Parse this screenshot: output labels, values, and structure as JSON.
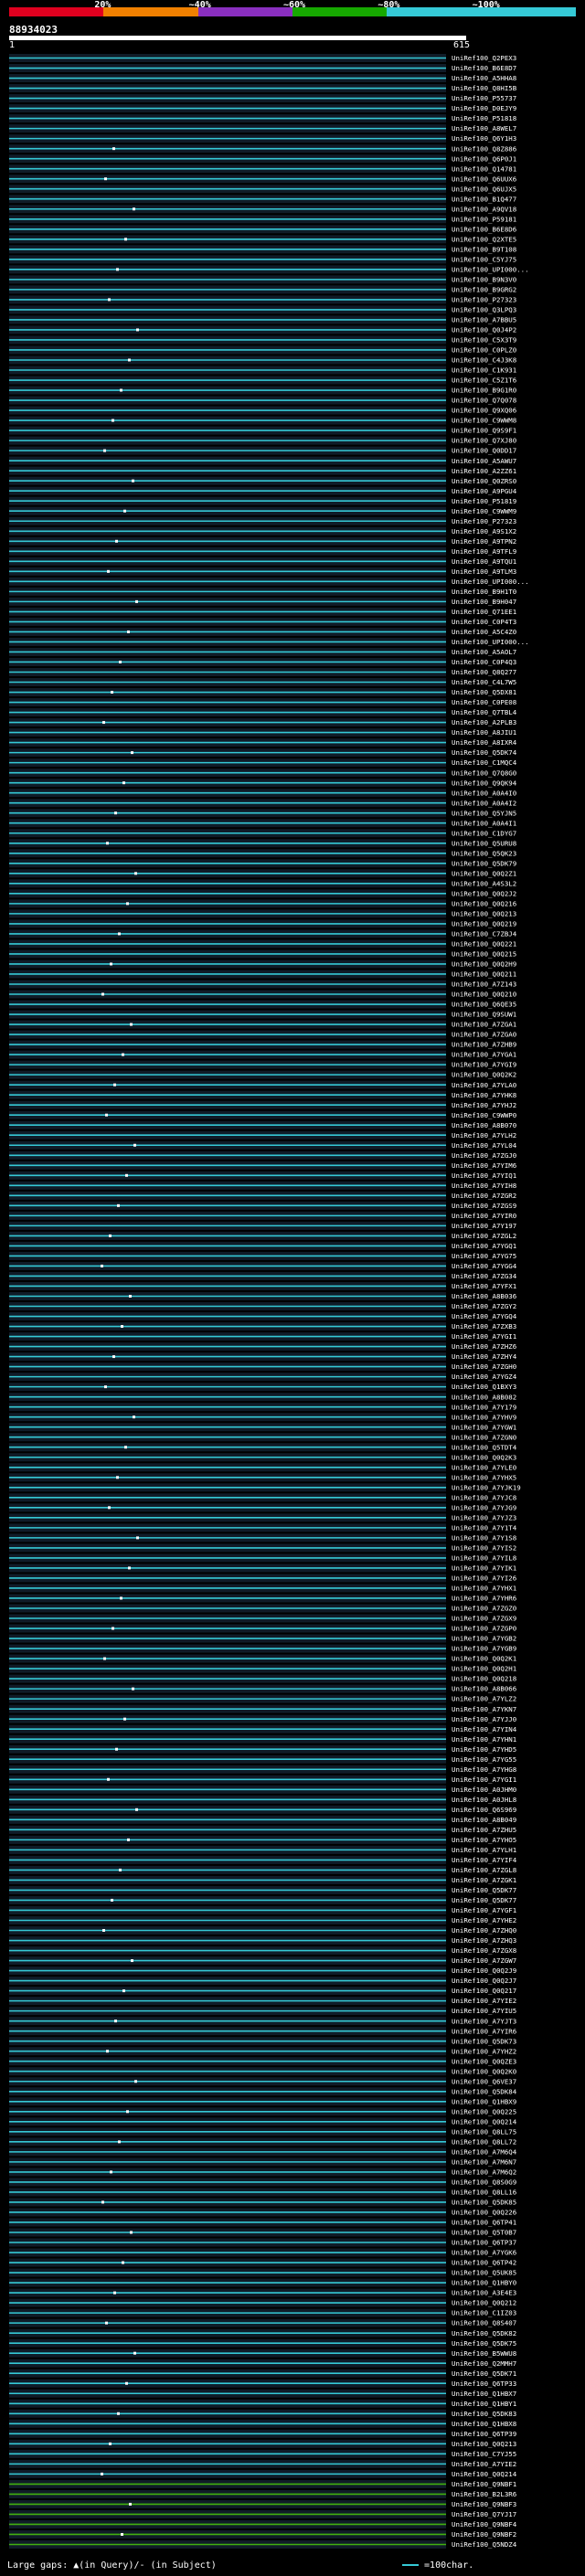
{
  "header": {
    "legend": [
      {
        "label": "",
        "color": "#e0001f"
      },
      {
        "label": "20%",
        "color": "#f08000"
      },
      {
        "label": "~40%",
        "color": "#8a2fc0"
      },
      {
        "label": "~60%",
        "color": "#16a800"
      },
      {
        "label": "~80%",
        "color": "#35c9d6"
      },
      {
        "label": "~100%",
        "color": "#35c9d6"
      }
    ],
    "query_id": "88934023",
    "scale_start": "1",
    "scale_end": "615"
  },
  "colors": {
    "hit": "#35c9d6",
    "hit_green": "#41b010",
    "gap": "#101c28",
    "dot": "#ffffff"
  },
  "hits": [
    "UniRef100_Q2PEX3",
    "UniRef100_B6E8D7",
    "UniRef100_A5HHA8",
    "UniRef100_Q8HI5B",
    "UniRef100_P55737",
    "UniRef100_D0EJY9",
    "UniRef100_P51818",
    "UniRef100_A8WEL7",
    "UniRef100_Q6Y1H3",
    "UniRef100_Q8Z886",
    "UniRef100_Q6P0J1",
    "UniRef100_Q14781",
    "UniRef100_Q6UUX6",
    "UniRef100_Q6UJX5",
    "UniRef100_B1Q477",
    "UniRef100_A9QV18",
    "UniRef100_P59181",
    "UniRef100_B6E8D6",
    "UniRef100_Q2XTE5",
    "UniRef100_B9T108",
    "UniRef100_C5YJ75",
    "UniRef100_UPI000...",
    "UniRef100_B9N3V0",
    "UniRef100_B9GRG2",
    "UniRef100_P27323",
    "UniRef100_Q3LPQ3",
    "UniRef100_A7BBU5",
    "UniRef100_Q0J4P2",
    "UniRef100_C5X3T9",
    "UniRef100_C0PLZ0",
    "UniRef100_C4J3K8",
    "UniRef100_C1K931",
    "UniRef100_C5Z1T6",
    "UniRef100_B9G1R0",
    "UniRef100_Q7Q078",
    "UniRef100_Q9XQ06",
    "UniRef100_C9WWM8",
    "UniRef100_Q9S9F1",
    "UniRef100_Q7XJ80",
    "UniRef100_Q0DD17",
    "UniRef100_A5AWU7",
    "UniRef100_A2ZZ61",
    "UniRef100_Q0ZRS0",
    "UniRef100_A9PGU4",
    "UniRef100_P51819",
    "UniRef100_C9WWM9",
    "UniRef100_P27323",
    "UniRef100_A9S1X2",
    "UniRef100_A9TPN2",
    "UniRef100_A9TFL9",
    "UniRef100_A9TQU1",
    "UniRef100_A9TLM3",
    "UniRef100_UPI000...",
    "UniRef100_B9H1T0",
    "UniRef100_B9H047",
    "UniRef100_Q71EE1",
    "UniRef100_C0P4T3",
    "UniRef100_A5C4Z0",
    "UniRef100_UPI000...",
    "UniRef100_A5AOL7",
    "UniRef100_C0P4Q3",
    "UniRef100_Q8Q277",
    "UniRef100_C4L7W5",
    "UniRef100_Q5DX81",
    "UniRef100_C0PE08",
    "UniRef100_Q7TBL4",
    "UniRef100_A2PLB3",
    "UniRef100_A8JIU1",
    "UniRef100_A8IXR4",
    "UniRef100_Q5DK74",
    "UniRef100_C1MQC4",
    "UniRef100_Q7Q8G0",
    "UniRef100_Q9QK94",
    "UniRef100_A0A4I0",
    "UniRef100_A0A4I2",
    "UniRef100_Q5YJN5",
    "UniRef100_A0A4I1",
    "UniRef100_C1DYG7",
    "UniRef100_Q5URU8",
    "UniRef100_Q5QK23",
    "UniRef100_Q5DK79",
    "UniRef100_Q0Q2Z1",
    "UniRef100_A4S3L2",
    "UniRef100_Q0Q2J2",
    "UniRef100_Q0Q216",
    "UniRef100_Q0Q213",
    "UniRef100_Q0Q219",
    "UniRef100_C7ZBJ4",
    "UniRef100_Q0Q221",
    "UniRef100_Q0Q215",
    "UniRef100_Q0Q2H9",
    "UniRef100_Q0Q211",
    "UniRef100_A7Z143",
    "UniRef100_Q0Q210",
    "UniRef100_Q6QE35",
    "UniRef100_Q9SUW1",
    "UniRef100_A7ZGA1",
    "UniRef100_A7ZGA0",
    "UniRef100_A7ZHB9",
    "UniRef100_A7YGA1",
    "UniRef100_A7YGI9",
    "UniRef100_Q0Q2K2",
    "UniRef100_A7YLA0",
    "UniRef100_A7YHK8",
    "UniRef100_A7YHJ2",
    "UniRef100_C9WWP0",
    "UniRef100_A8B070",
    "UniRef100_A7YLH2",
    "UniRef100_A7YL04",
    "UniRef100_A7ZGJ0",
    "UniRef100_A7YIM6",
    "UniRef100_A7YIQ1",
    "UniRef100_A7YIH8",
    "UniRef100_A7ZGR2",
    "UniRef100_A7ZGS9",
    "UniRef100_A7YIR0",
    "UniRef100_A7Y197",
    "UniRef100_A7ZGL2",
    "UniRef100_A7YGQ1",
    "UniRef100_A7YG75",
    "UniRef100_A7YGG4",
    "UniRef100_A7ZG34",
    "UniRef100_A7YFX1",
    "UniRef100_A8B036",
    "UniRef100_A7ZGY2",
    "UniRef100_A7YGQ4",
    "UniRef100_A7ZXB3",
    "UniRef100_A7YGI1",
    "UniRef100_A7ZHZ6",
    "UniRef100_A7ZHY4",
    "UniRef100_A7ZGH0",
    "UniRef100_A7YGZ4",
    "UniRef100_Q1BXY3",
    "UniRef100_A8B082",
    "UniRef100_A7Y179",
    "UniRef100_A7YHV9",
    "UniRef100_A7YGW1",
    "UniRef100_A7ZGN0",
    "UniRef100_Q5TDT4",
    "UniRef100_Q0Q2K3",
    "UniRef100_A7YLE0",
    "UniRef100_A7YHX5",
    "UniRef100_A7YJK19",
    "UniRef100_A7YJC8",
    "UniRef100_A7YJG9",
    "UniRef100_A7YJZ3",
    "UniRef100_A7Y1T4",
    "UniRef100_A7Y1S8",
    "UniRef100_A7YIS2",
    "UniRef100_A7YIL8",
    "UniRef100_A7YIK1",
    "UniRef100_A7YI26",
    "UniRef100_A7YHX1",
    "UniRef100_A7YHR6",
    "UniRef100_A7ZGZ0",
    "UniRef100_A7ZGX9",
    "UniRef100_A7ZGP0",
    "UniRef100_A7YGB2",
    "UniRef100_A7YGB9",
    "UniRef100_Q0Q2K1",
    "UniRef100_Q0Q2H1",
    "UniRef100_Q0Q218",
    "UniRef100_A8B066",
    "UniRef100_A7YLZ2",
    "UniRef100_A7YKN7",
    "UniRef100_A7YJJ0",
    "UniRef100_A7YIN4",
    "UniRef100_A7YHN1",
    "UniRef100_A7YHD5",
    "UniRef100_A7YG55",
    "UniRef100_A7YHG8",
    "UniRef100_A7YGI1",
    "UniRef100_A0JHM0",
    "UniRef100_A0JHL8",
    "UniRef100_Q6S969",
    "UniRef100_A8B049",
    "UniRef100_A7ZHU5",
    "UniRef100_A7YHO5",
    "UniRef100_A7YLH1",
    "UniRef100_A7YIF4",
    "UniRef100_A7ZGL8",
    "UniRef100_A7ZGK1",
    "UniRef100_Q5DK77",
    "UniRef100_Q5DK77",
    "UniRef100_A7YGF1",
    "UniRef100_A7YHE2",
    "UniRef100_A7ZHQ0",
    "UniRef100_A7ZHQ3",
    "UniRef100_A7ZGX8",
    "UniRef100_A7ZGW7",
    "UniRef100_Q0Q2J9",
    "UniRef100_Q0Q2J7",
    "UniRef100_Q0Q217",
    "UniRef100_A7YIE2",
    "UniRef100_A7YIU5",
    "UniRef100_A7YJT3",
    "UniRef100_A7YIR6",
    "UniRef100_Q5DK73",
    "UniRef100_A7YHZ2",
    "UniRef100_Q0QZE3",
    "UniRef100_Q0Q2K0",
    "UniRef100_Q6VE37",
    "UniRef100_Q5DK84",
    "UniRef100_Q1HBX9",
    "UniRef100_Q0Q225",
    "UniRef100_Q0Q214",
    "UniRef100_Q8LL75",
    "UniRef100_Q8LL72",
    "UniRef100_A7M6Q4",
    "UniRef100_A7M6N7",
    "UniRef100_A7M6Q2",
    "UniRef100_Q8S0G9",
    "UniRef100_Q8LL16",
    "UniRef100_Q5DK85",
    "UniRef100_Q0Q226",
    "UniRef100_Q6TP41",
    "UniRef100_Q5T0B7",
    "UniRef100_Q6TP37",
    "UniRef100_A7YGK6",
    "UniRef100_Q6TP42",
    "UniRef100_Q5UK85",
    "UniRef100_Q1HBY0",
    "UniRef100_A3E4E3",
    "UniRef100_Q0Q212",
    "UniRef100_C1IZ03",
    "UniRef100_Q8S407",
    "UniRef100_Q5DK82",
    "UniRef100_Q5DK75",
    "UniRef100_B5WWU8",
    "UniRef100_Q2MMH7",
    "UniRef100_Q5DK71",
    "UniRef100_Q6TP33",
    "UniRef100_Q1HBX7",
    "UniRef100_Q1HBY1",
    "UniRef100_Q5DK83",
    "UniRef100_Q1HBX8",
    "UniRef100_Q6TP39",
    "UniRef100_Q0Q213",
    "UniRef100_C7YJ55",
    "UniRef100_A7YIE2",
    "UniRef100_Q0Q214",
    "UniRef100_Q9NBF1",
    "UniRef100_B2L3R6",
    "UniRef100_Q9NBF3",
    "UniRef100_Q7YJ17",
    "UniRef100_Q9NBF4",
    "UniRef100_Q9NBF2",
    "UniRef100_Q5NDZ4"
  ],
  "footer": {
    "large_gaps": "Large gaps: ▲(in Query)/- (in Subject)",
    "scale_note": "=100char."
  }
}
